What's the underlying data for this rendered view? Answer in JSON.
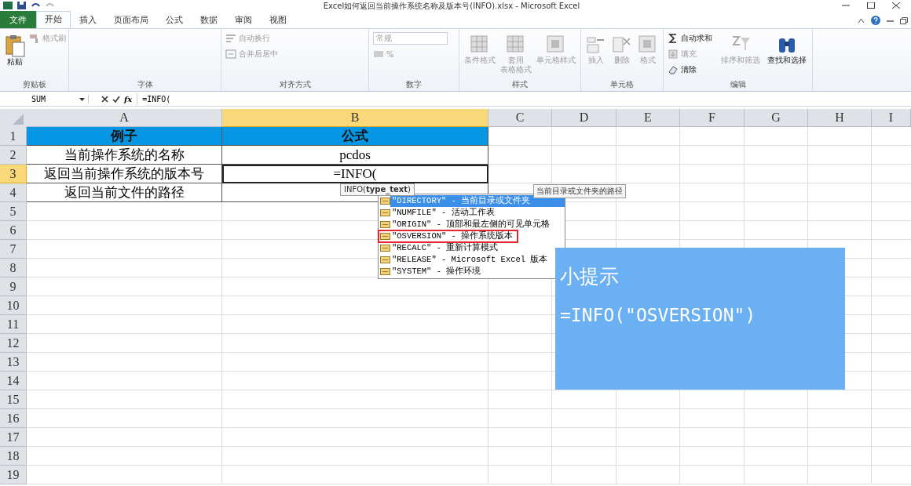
{
  "window": {
    "title": "Excel如何返回当前操作系统名称及版本号(INFO).xlsx - Microsoft Excel"
  },
  "ribbon_tabs": [
    {
      "label": "文件",
      "kind": "file",
      "selected": false
    },
    {
      "label": "开始",
      "kind": "tab",
      "selected": true
    },
    {
      "label": "插入",
      "kind": "tab",
      "selected": false
    },
    {
      "label": "页面布局",
      "kind": "tab",
      "selected": false
    },
    {
      "label": "公式",
      "kind": "tab",
      "selected": false
    },
    {
      "label": "数据",
      "kind": "tab",
      "selected": false
    },
    {
      "label": "审阅",
      "kind": "tab",
      "selected": false
    },
    {
      "label": "视图",
      "kind": "tab",
      "selected": false
    }
  ],
  "ribbon_groups": [
    {
      "label": "剪贴板",
      "items": [
        {
          "kind": "large",
          "lines": [
            "粘贴"
          ],
          "disabled": false
        },
        {
          "kind": "small",
          "lines": [
            "格式刷"
          ],
          "disabled": true
        }
      ]
    },
    {
      "label": "字体"
    },
    {
      "label": "对齐方式",
      "items": [
        {
          "kind": "small",
          "lines": [
            "自动换行"
          ],
          "disabled": true
        },
        {
          "kind": "small",
          "lines": [
            "合并后居中"
          ],
          "disabled": true
        }
      ]
    },
    {
      "label": "数字",
      "items": [
        {
          "kind": "dropdown",
          "lines": [
            "常规"
          ],
          "disabled": true
        },
        {
          "kind": "small",
          "lines": [
            "%"
          ],
          "disabled": true
        }
      ]
    },
    {
      "label": "样式",
      "items": [
        {
          "kind": "large",
          "lines": [
            "条件格式"
          ],
          "disabled": true
        },
        {
          "kind": "large",
          "lines": [
            "套用",
            "表格格式"
          ],
          "disabled": true
        },
        {
          "kind": "large",
          "lines": [
            "单元格样式"
          ],
          "disabled": true
        }
      ]
    },
    {
      "label": "单元格",
      "items": [
        {
          "kind": "large",
          "lines": [
            "插入"
          ],
          "disabled": true
        },
        {
          "kind": "large",
          "lines": [
            "删除"
          ],
          "disabled": true
        },
        {
          "kind": "large",
          "lines": [
            "格式"
          ],
          "disabled": true
        }
      ]
    },
    {
      "label": "编辑",
      "items": [
        {
          "kind": "small",
          "lines": [
            "自动求和"
          ],
          "disabled": false
        },
        {
          "kind": "small",
          "lines": [
            "填充"
          ],
          "disabled": true
        },
        {
          "kind": "small",
          "lines": [
            "清除"
          ],
          "disabled": false
        },
        {
          "kind": "large",
          "lines": [
            "排序和筛选"
          ],
          "disabled": true
        },
        {
          "kind": "large",
          "lines": [
            "查找和选择"
          ],
          "disabled": false
        }
      ]
    }
  ],
  "formula_bar": {
    "name_box": "SUM",
    "function_button": "fx",
    "formula": "=INFO("
  },
  "columns": [
    {
      "label": "A",
      "selected": false
    },
    {
      "label": "B",
      "selected": true
    },
    {
      "label": "C",
      "selected": false
    },
    {
      "label": "D",
      "selected": false
    },
    {
      "label": "E",
      "selected": false
    },
    {
      "label": "F",
      "selected": false
    },
    {
      "label": "G",
      "selected": false
    },
    {
      "label": "H",
      "selected": false
    },
    {
      "label": "I",
      "selected": false
    }
  ],
  "rows": [
    {
      "label": "1",
      "selected": false,
      "kind": "header",
      "cells": [
        "例子",
        "公式"
      ]
    },
    {
      "label": "2",
      "selected": false,
      "kind": "data",
      "cells": [
        "当前操作系统的名称",
        "pcdos"
      ]
    },
    {
      "label": "3",
      "selected": true,
      "kind": "data",
      "cells": [
        "返回当前操作系统的版本号",
        "=INFO("
      ]
    },
    {
      "label": "4",
      "selected": false,
      "kind": "data",
      "cells": [
        "返回当前文件的路径",
        ""
      ]
    },
    {
      "label": "5",
      "selected": false
    },
    {
      "label": "6",
      "selected": false
    },
    {
      "label": "7",
      "selected": false
    },
    {
      "label": "8",
      "selected": false
    },
    {
      "label": "9",
      "selected": false
    },
    {
      "label": "10",
      "selected": false
    },
    {
      "label": "11",
      "selected": false
    },
    {
      "label": "12",
      "selected": false
    },
    {
      "label": "13",
      "selected": false
    },
    {
      "label": "14",
      "selected": false
    },
    {
      "label": "15",
      "selected": false
    },
    {
      "label": "16",
      "selected": false
    },
    {
      "label": "17",
      "selected": false
    },
    {
      "label": "18",
      "selected": false
    },
    {
      "label": "19",
      "selected": false
    }
  ],
  "function_hint": "INFO(**type_text**)",
  "autocomplete": [
    {
      "label": "\"DIRECTORY\" - 当前目录或文件夹",
      "selected": true,
      "outlined": false
    },
    {
      "label": "\"NUMFILE\" - 活动工作表",
      "selected": false,
      "outlined": false
    },
    {
      "label": "\"ORIGIN\" - 顶部和最左侧的可见单元格",
      "selected": false,
      "outlined": false
    },
    {
      "label": "\"OSVERSION\" - 操作系统版本",
      "selected": false,
      "outlined": true
    },
    {
      "label": "\"RECALC\" - 重新计算模式",
      "selected": false,
      "outlined": false
    },
    {
      "label": "\"RELEASE\" - Microsoft Excel 版本",
      "selected": false,
      "outlined": false
    },
    {
      "label": "\"SYSTEM\" - 操作环境",
      "selected": false,
      "outlined": false
    }
  ],
  "item_tooltip": "当前目录或文件夹的路径",
  "tip_card": {
    "title": "小提示",
    "text": "=INFO(\"OSVERSION\")"
  }
}
